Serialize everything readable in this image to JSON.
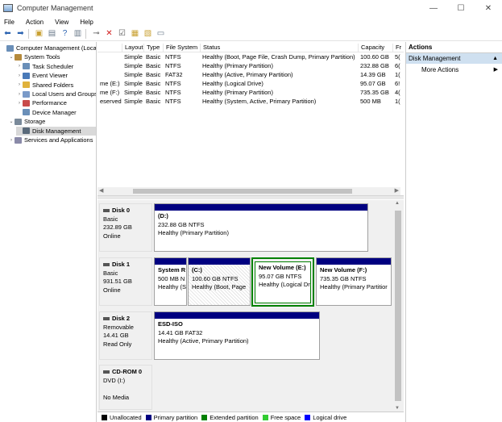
{
  "window": {
    "title": "Computer Management",
    "controls": [
      "—",
      "☐",
      "✕"
    ]
  },
  "menu": [
    "File",
    "Action",
    "View",
    "Help"
  ],
  "tree": [
    {
      "label": "Computer Management (Local)",
      "level": 0,
      "arrow": "",
      "icon": "computer-icon",
      "color": "#6a8fb8",
      "selected": false
    },
    {
      "label": "System Tools",
      "level": 1,
      "arrow": "⌄",
      "icon": "tools-icon",
      "color": "#b58a3c",
      "selected": false
    },
    {
      "label": "Task Scheduler",
      "level": 2,
      "arrow": "›",
      "icon": "clock-icon",
      "color": "#6a8fb8",
      "selected": false
    },
    {
      "label": "Event Viewer",
      "level": 2,
      "arrow": "›",
      "icon": "event-icon",
      "color": "#4a7ab8",
      "selected": false
    },
    {
      "label": "Shared Folders",
      "level": 2,
      "arrow": "›",
      "icon": "folder-icon",
      "color": "#e0b23c",
      "selected": false
    },
    {
      "label": "Local Users and Groups",
      "level": 2,
      "arrow": "›",
      "icon": "users-icon",
      "color": "#7a9ac8",
      "selected": false
    },
    {
      "label": "Performance",
      "level": 2,
      "arrow": "›",
      "icon": "performance-icon",
      "color": "#c84a4a",
      "selected": false
    },
    {
      "label": "Device Manager",
      "level": 2,
      "arrow": "",
      "icon": "device-icon",
      "color": "#6a8fb8",
      "selected": false
    },
    {
      "label": "Storage",
      "level": 1,
      "arrow": "⌄",
      "icon": "storage-icon",
      "color": "#7a8a9a",
      "selected": false
    },
    {
      "label": "Disk Management",
      "level": 2,
      "arrow": "",
      "icon": "disk-icon",
      "color": "#5a6a7a",
      "selected": true
    },
    {
      "label": "Services and Applications",
      "level": 1,
      "arrow": "›",
      "icon": "services-icon",
      "color": "#8a8aa8",
      "selected": false
    }
  ],
  "volume_list": {
    "columns": [
      "",
      "Layout",
      "Type",
      "File System",
      "Status",
      "Capacity",
      "Fr"
    ],
    "rows": [
      [
        "",
        "Simple",
        "Basic",
        "NTFS",
        "Healthy (Boot, Page File, Crash Dump, Primary Partition)",
        "100.60 GB",
        "5("
      ],
      [
        "",
        "Simple",
        "Basic",
        "NTFS",
        "Healthy (Primary Partition)",
        "232.88 GB",
        "6("
      ],
      [
        "",
        "Simple",
        "Basic",
        "FAT32",
        "Healthy (Active, Primary Partition)",
        "14.39 GB",
        "1("
      ],
      [
        "me (E:)",
        "Simple",
        "Basic",
        "NTFS",
        "Healthy (Logical Drive)",
        "95.07 GB",
        "6!"
      ],
      [
        "me (F:)",
        "Simple",
        "Basic",
        "NTFS",
        "Healthy (Primary Partition)",
        "735.35 GB",
        "4("
      ],
      [
        "eserved",
        "Simple",
        "Basic",
        "NTFS",
        "Healthy (System, Active, Primary Partition)",
        "500 MB",
        "1("
      ]
    ]
  },
  "disks": [
    {
      "name": "Disk 0",
      "lines": [
        "Basic",
        "232.89 GB",
        "Online"
      ]
    },
    {
      "name": "Disk 1",
      "lines": [
        "Basic",
        "931.51 GB",
        "Online"
      ]
    },
    {
      "name": "Disk 2",
      "lines": [
        "Removable",
        "14.41 GB",
        "Read Only"
      ]
    },
    {
      "name": "CD-ROM 0",
      "lines": [
        "DVD (I:)",
        "",
        "No Media"
      ]
    }
  ],
  "partitions": {
    "d0": {
      "name": "(D:)",
      "size": "232.88 GB NTFS",
      "status": "Healthy (Primary Partition)"
    },
    "d1_sys": {
      "name": "System R",
      "size": "500 MB N",
      "status": "Healthy (S"
    },
    "d1_c": {
      "name": "(C:)",
      "size": "100.60 GB NTFS",
      "status": "Healthy (Boot, Page"
    },
    "d1_e": {
      "name": "New Volume  (E:)",
      "size": "95.07 GB NTFS",
      "status": "Healthy (Logical Dr"
    },
    "d1_f": {
      "name": "New Volume  (F:)",
      "size": "735.35 GB NTFS",
      "status": "Healthy (Primary Partitior"
    },
    "d2": {
      "name": "ESD-ISO",
      "size": "14.41 GB FAT32",
      "status": "Healthy (Active, Primary Partition)"
    }
  },
  "legend": [
    {
      "label": "Unallocated",
      "color": "#000000"
    },
    {
      "label": "Primary partition",
      "color": "#000080"
    },
    {
      "label": "Extended partition",
      "color": "#008000"
    },
    {
      "label": "Free space",
      "color": "#33cc33"
    },
    {
      "label": "Logical drive",
      "color": "#0000ff"
    }
  ],
  "actions": {
    "header": "Actions",
    "section": "Disk Management",
    "items": [
      "More Actions"
    ]
  }
}
